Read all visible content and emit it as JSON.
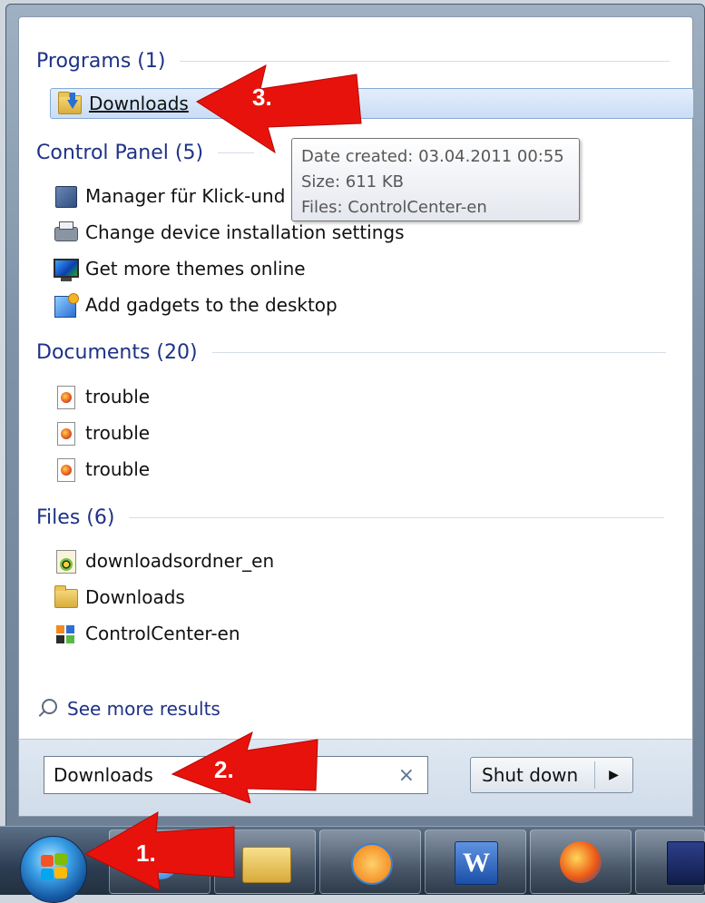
{
  "sections": {
    "programs": {
      "title": "Programs (1)"
    },
    "control_panel": {
      "title": "Control Panel (5)"
    },
    "documents": {
      "title": "Documents (20)"
    },
    "files": {
      "title": "Files (6)"
    }
  },
  "programs_items": [
    {
      "label": "Downloads",
      "icon": "folder-download-icon",
      "selected": true
    }
  ],
  "control_panel_items": [
    {
      "label": "Manager für Klick-und",
      "icon": "control-panel-icon"
    },
    {
      "label": "Change device installation settings",
      "icon": "printer-icon"
    },
    {
      "label": "Get more themes online",
      "icon": "monitor-icon"
    },
    {
      "label": "Add gadgets to the desktop",
      "icon": "gadget-icon"
    }
  ],
  "documents_items": [
    {
      "label": "trouble",
      "icon": "firefox-document-icon"
    },
    {
      "label": "trouble",
      "icon": "firefox-document-icon"
    },
    {
      "label": "trouble",
      "icon": "firefox-document-icon"
    }
  ],
  "files_items": [
    {
      "label": "downloadsordner_en",
      "icon": "download-file-icon"
    },
    {
      "label": "Downloads",
      "icon": "folder-icon"
    },
    {
      "label": "ControlCenter-en",
      "icon": "control-center-icon"
    }
  ],
  "tooltip": {
    "date_created": "Date created: 03.04.2011 00:55",
    "size": "Size: 611 KB",
    "files": "Files: ControlCenter-en"
  },
  "see_more": "See more results",
  "search": {
    "value": "Downloads",
    "clear_icon": "×"
  },
  "shutdown": {
    "label": "Shut down",
    "arrow": "▶"
  },
  "annotations": {
    "step1": "1.",
    "step2": "2.",
    "step3": "3."
  },
  "colors": {
    "section_header": "#1e3287",
    "annotation_red": "#e8120c",
    "selection": "#c9ddf5"
  }
}
